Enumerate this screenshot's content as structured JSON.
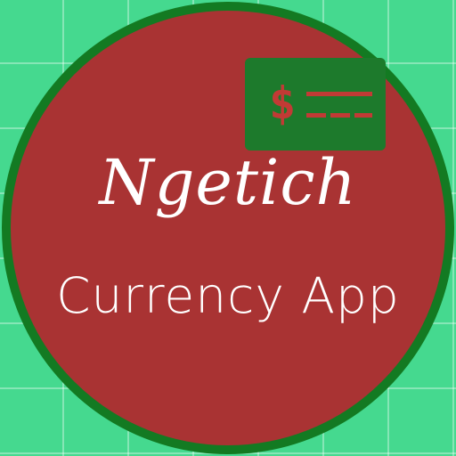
{
  "colors": {
    "background_green": "#45d98f",
    "circle_red": "#a93333",
    "circle_border_green": "#137a22",
    "card_green": "#1d7a2c",
    "card_symbol_red": "#c23a35",
    "text_white": "#ffffff"
  },
  "icon": {
    "name": "money-card-icon",
    "symbol": "$"
  },
  "title": "Ngetich",
  "subtitle": "Currency App"
}
